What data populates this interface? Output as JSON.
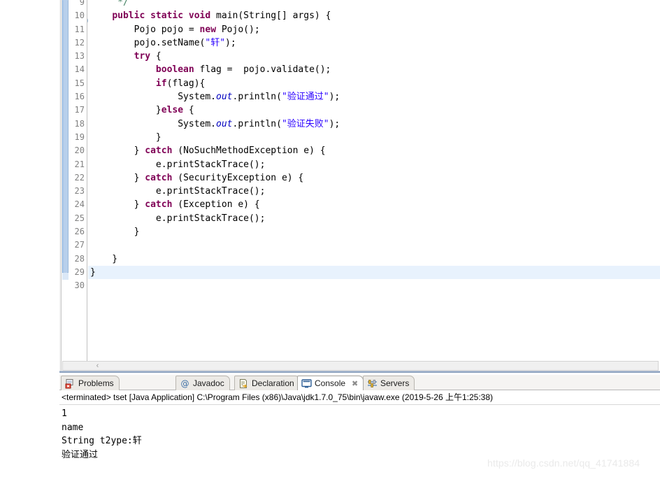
{
  "editor": {
    "first_line_number": 9,
    "last_line_number": 30,
    "current_line": 29,
    "fold_marker_line": 10,
    "scrollbar": {
      "left_arrow": "‹"
    },
    "line_numbers": [
      "9",
      "10",
      "11",
      "12",
      "13",
      "14",
      "15",
      "16",
      "17",
      "18",
      "19",
      "20",
      "21",
      "22",
      "23",
      "24",
      "25",
      "26",
      "27",
      "28",
      "29",
      "30"
    ],
    "lines": [
      {
        "n": "9",
        "text": "     */"
      },
      {
        "n": "10",
        "text": "    public static void main(String[] args) {"
      },
      {
        "n": "11",
        "text": "        Pojo pojo = new Pojo();"
      },
      {
        "n": "12",
        "text": "        pojo.setName(\"轩\");"
      },
      {
        "n": "13",
        "text": "        try {"
      },
      {
        "n": "14",
        "text": "            boolean flag =  pojo.validate();"
      },
      {
        "n": "15",
        "text": "            if(flag){"
      },
      {
        "n": "16",
        "text": "                System.out.println(\"验证通过\");"
      },
      {
        "n": "17",
        "text": "            }else {"
      },
      {
        "n": "18",
        "text": "                System.out.println(\"验证失败\");"
      },
      {
        "n": "19",
        "text": "            }"
      },
      {
        "n": "20",
        "text": "        } catch (NoSuchMethodException e) {"
      },
      {
        "n": "21",
        "text": "            e.printStackTrace();"
      },
      {
        "n": "22",
        "text": "        } catch (SecurityException e) {"
      },
      {
        "n": "23",
        "text": "            e.printStackTrace();"
      },
      {
        "n": "24",
        "text": "        } catch (Exception e) {"
      },
      {
        "n": "25",
        "text": "            e.printStackTrace();"
      },
      {
        "n": "26",
        "text": "        }"
      },
      {
        "n": "27",
        "text": ""
      },
      {
        "n": "28",
        "text": "    }"
      },
      {
        "n": "29",
        "text": "}"
      },
      {
        "n": "30",
        "text": ""
      }
    ]
  },
  "bottom_panel": {
    "tabs": [
      {
        "label": "Problems",
        "icon": "problems-icon",
        "active": false,
        "closeable": false
      },
      {
        "label": "Javadoc",
        "icon": "javadoc-icon",
        "active": false,
        "closeable": false
      },
      {
        "label": "Declaration",
        "icon": "declaration-icon",
        "active": false,
        "closeable": false
      },
      {
        "label": "Console",
        "icon": "console-icon",
        "active": true,
        "closeable": true,
        "close_glyph": "✖"
      },
      {
        "label": "Servers",
        "icon": "servers-icon",
        "active": false,
        "closeable": false
      }
    ],
    "console": {
      "header": "<terminated> tset [Java Application] C:\\Program Files (x86)\\Java\\jdk1.7.0_75\\bin\\javaw.exe (2019-5-26 上午1:25:38)",
      "output": [
        "1",
        "name",
        "String t2ype:轩",
        "验证通过"
      ]
    }
  },
  "watermark": {
    "text": "https://blog.csdn.net/qq_41741884"
  },
  "colors": {
    "keyword": "#7f0055",
    "string": "#2a00ff",
    "comment": "#3f7f5f",
    "static_field": "#0000c0",
    "current_line_highlight": "#e8f2fd",
    "gutter_text": "#808080",
    "change_bar": "#6f9fd8"
  }
}
